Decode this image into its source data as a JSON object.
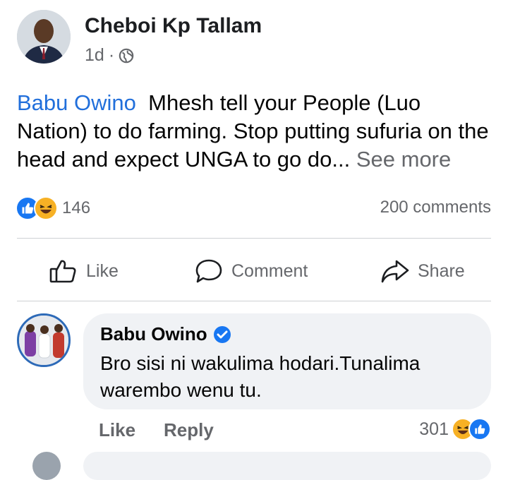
{
  "post": {
    "author": "Cheboi Kp Tallam",
    "time": "1d",
    "separator": "·",
    "mention": "Babu Owino",
    "body": "Mhesh tell your People (Luo Nation) to do farming. Stop putting sufuria on the head and expect UNGA to go do...",
    "see_more": "See more",
    "reaction_count": "146",
    "comments_count": "200 comments"
  },
  "actions": {
    "like": "Like",
    "comment": "Comment",
    "share": "Share"
  },
  "comment": {
    "author": "Babu Owino",
    "text": "Bro sisi ni wakulima hodari.Tunalima warembo wenu tu.",
    "like_label": "Like",
    "reply_label": "Reply",
    "reaction_count": "301"
  },
  "colors": {
    "link": "#216fdb",
    "like_blue": "#1877f2",
    "haha_yellow": "#f7b125",
    "muted": "#65676b",
    "bubble": "#f0f2f5"
  },
  "icons": [
    "globe-icon",
    "like-reaction-icon",
    "haha-reaction-icon",
    "thumbs-up-icon",
    "comment-icon",
    "share-icon",
    "verified-icon"
  ]
}
